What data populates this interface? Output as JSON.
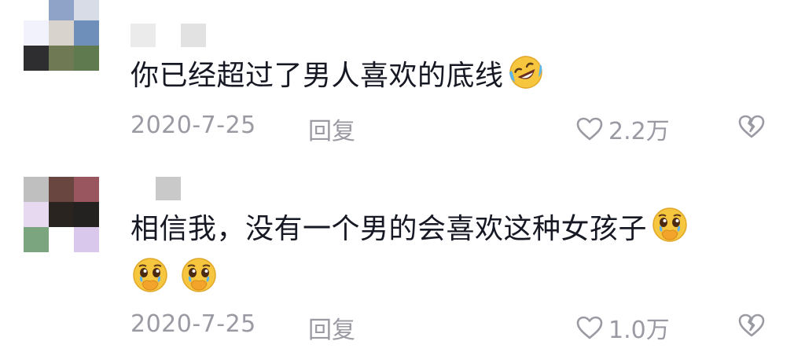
{
  "comments": [
    {
      "text": "你已经超过了男人喜欢的底线",
      "emojis": [
        "rofl-emoji"
      ],
      "date": "2020-7-25",
      "reply_label": "回复",
      "likes": "2.2万",
      "avatar_colors": [
        "#ffffff",
        "#8fa3c9",
        "#d7dce6",
        "#f1f2fb",
        "#d9d3cd",
        "#6e8fb9",
        "#2e2d2f",
        "#6f7a54",
        "#5f7a4e"
      ],
      "username_colors": [
        "#ebebeb",
        "#ffffff",
        "#e2e2e2"
      ]
    },
    {
      "text": "相信我，没有一个男的会喜欢这种女孩子",
      "emojis": [
        "pleading-tears-emoji",
        "pleading-tears-emoji",
        "pleading-tears-emoji"
      ],
      "date": "2020-7-25",
      "reply_label": "回复",
      "likes": "1.0万",
      "avatar_colors": [
        "#bfbfbf",
        "#6a4641",
        "#99565e",
        "#e7daf0",
        "#2a2420",
        "#232220",
        "#7aa57f",
        "#ffffff",
        "#dac8ec"
      ],
      "username_colors": [
        "#ffffff",
        "#c9c9c9"
      ]
    }
  ]
}
